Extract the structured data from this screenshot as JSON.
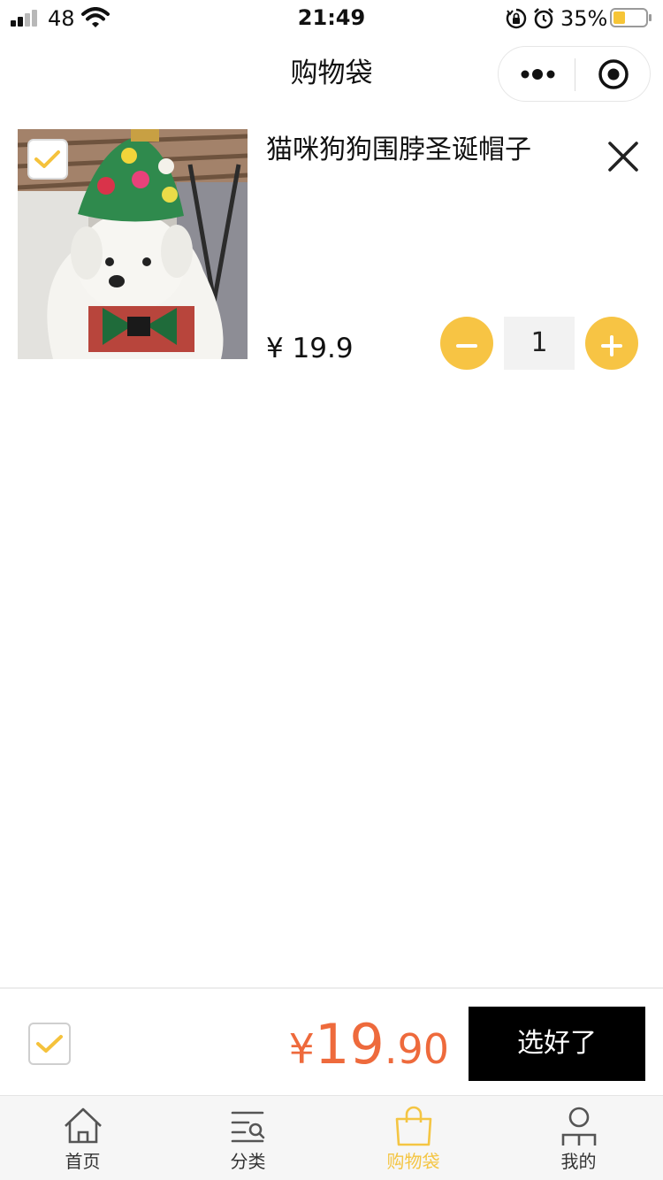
{
  "status_bar": {
    "carrier": "48",
    "time": "21:49",
    "battery_percent": "35%",
    "battery_level": 0.35
  },
  "nav": {
    "title": "购物袋",
    "capsule_more_icon": "more-dots-icon",
    "capsule_close_icon": "target-icon"
  },
  "cart": {
    "items": [
      {
        "name": "猫咪狗狗围脖圣诞帽子",
        "price": "¥ 19.9",
        "quantity": "1",
        "checked": true
      }
    ]
  },
  "checkout": {
    "total_symbol": "¥",
    "total_integer": "19",
    "total_decimal": ".90",
    "confirm_label": "选好了",
    "select_all_checked": true
  },
  "tabbar": {
    "tabs": [
      {
        "label": "首页",
        "icon": "home-icon",
        "active": false
      },
      {
        "label": "分类",
        "icon": "category-search-icon",
        "active": false
      },
      {
        "label": "购物袋",
        "icon": "shopping-bag-icon",
        "active": true
      },
      {
        "label": "我的",
        "icon": "profile-icon",
        "active": false
      }
    ]
  },
  "colors": {
    "accent_yellow": "#f7c444",
    "tab_active": "#f4c543",
    "price_total": "#ee6a3c",
    "confirm_bg": "#000000"
  }
}
